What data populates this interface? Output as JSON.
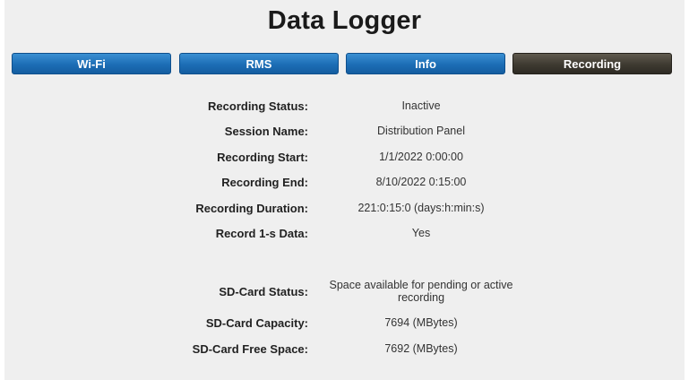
{
  "app": {
    "title": "Data Logger"
  },
  "tabs": [
    {
      "label": "Wi-Fi",
      "active": false
    },
    {
      "label": "RMS",
      "active": false
    },
    {
      "label": "Info",
      "active": false
    },
    {
      "label": "Recording",
      "active": true
    }
  ],
  "recording": {
    "status_label": "Recording Status:",
    "status_value": "Inactive",
    "session_label": "Session Name:",
    "session_value": "Distribution Panel",
    "start_label": "Recording Start:",
    "start_value": "1/1/2022 0:00:00",
    "end_label": "Recording End:",
    "end_value": "8/10/2022 0:15:00",
    "duration_label": "Recording Duration:",
    "duration_value": "221:0:15:0 (days:h:min:s)",
    "record1s_label": "Record 1-s Data:",
    "record1s_value": "Yes"
  },
  "sdcard": {
    "status_label": "SD-Card Status:",
    "status_value": "Space available for pending or active recording",
    "capacity_label": "SD-Card Capacity:",
    "capacity_value": "7694 (MBytes)",
    "free_label": "SD-Card Free Space:",
    "free_value": "7692 (MBytes)"
  },
  "colors": {
    "tab_blue": "#1c6db5",
    "tab_active": "#3e3a31",
    "panel_bg": "#efefef"
  }
}
